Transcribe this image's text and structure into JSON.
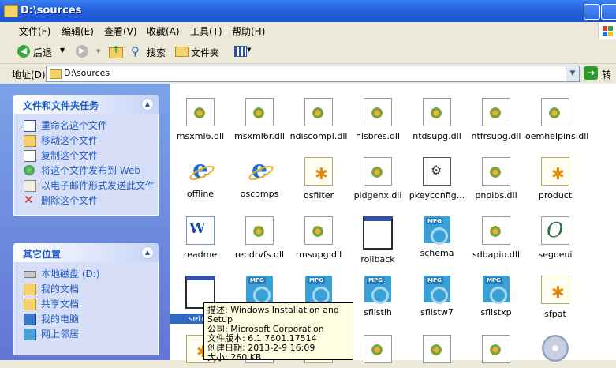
{
  "window": {
    "title": "D:\\sources"
  },
  "menu": [
    "文件(F)",
    "编辑(E)",
    "查看(V)",
    "收藏(A)",
    "工具(T)",
    "帮助(H)"
  ],
  "toolbar": {
    "back": "后退",
    "search": "搜索",
    "folders": "文件夹"
  },
  "address": {
    "label": "地址(D)",
    "value": "D:\\sources",
    "go": "转到"
  },
  "tasks_panel": {
    "title": "文件和文件夹任务",
    "items": [
      "重命名这个文件",
      "移动这个文件",
      "复制这个文件",
      "将这个文件发布到 Web",
      "以电子邮件形式发送此文件",
      "删除这个文件"
    ]
  },
  "places_panel": {
    "title": "其它位置",
    "items": [
      "本地磁盘 (D:)",
      "我的文档",
      "共享文档",
      "我的电脑",
      "网上邻居"
    ]
  },
  "files": [
    {
      "name": "msxml6.dll",
      "icon": "dll"
    },
    {
      "name": "msxml6r.dll",
      "icon": "dll"
    },
    {
      "name": "ndiscompl.dll",
      "icon": "dll"
    },
    {
      "name": "nlsbres.dll",
      "icon": "dll"
    },
    {
      "name": "ntdsupg.dll",
      "icon": "dll"
    },
    {
      "name": "ntfrsupg.dll",
      "icon": "dll"
    },
    {
      "name": "oemhelpins.dll",
      "icon": "dll"
    },
    {
      "name": "offline",
      "icon": "ie"
    },
    {
      "name": "oscomps",
      "icon": "ie"
    },
    {
      "name": "osfilter",
      "icon": "cfg"
    },
    {
      "name": "pidgenx.dll",
      "icon": "dll"
    },
    {
      "name": "pkeyconfig...",
      "icon": "pkey"
    },
    {
      "name": "pnpibs.dll",
      "icon": "dll"
    },
    {
      "name": "product",
      "icon": "cfg"
    },
    {
      "name": "readme",
      "icon": "word"
    },
    {
      "name": "repdrvfs.dll",
      "icon": "dll"
    },
    {
      "name": "rmsupg.dll",
      "icon": "dll"
    },
    {
      "name": "rollback",
      "icon": "app"
    },
    {
      "name": "schema",
      "icon": "mpg"
    },
    {
      "name": "sdbapiu.dll",
      "icon": "dll"
    },
    {
      "name": "segoeui",
      "icon": "font"
    },
    {
      "name": "setup",
      "icon": "app"
    },
    {
      "name": "",
      "icon": "mpg"
    },
    {
      "name": "",
      "icon": "mpg"
    },
    {
      "name": "sflistlh",
      "icon": "mpg"
    },
    {
      "name": "sflistw7",
      "icon": "mpg"
    },
    {
      "name": "sflistxp",
      "icon": "mpg"
    },
    {
      "name": "sfpat",
      "icon": "cfg"
    },
    {
      "name": "",
      "icon": "cfg"
    },
    {
      "name": "",
      "icon": "dll"
    },
    {
      "name": "",
      "icon": "cfg"
    },
    {
      "name": "",
      "icon": "dll"
    },
    {
      "name": "",
      "icon": "dll"
    },
    {
      "name": "",
      "icon": "dll"
    },
    {
      "name": "",
      "icon": "cd"
    }
  ],
  "tooltip": {
    "lines": [
      "描述: Windows Installation and Setup",
      "公司: Microsoft Corporation",
      "文件版本: 6.1.7601.17514",
      "创建日期: 2013-2-9 16:09",
      "大小: 260 KB"
    ]
  }
}
